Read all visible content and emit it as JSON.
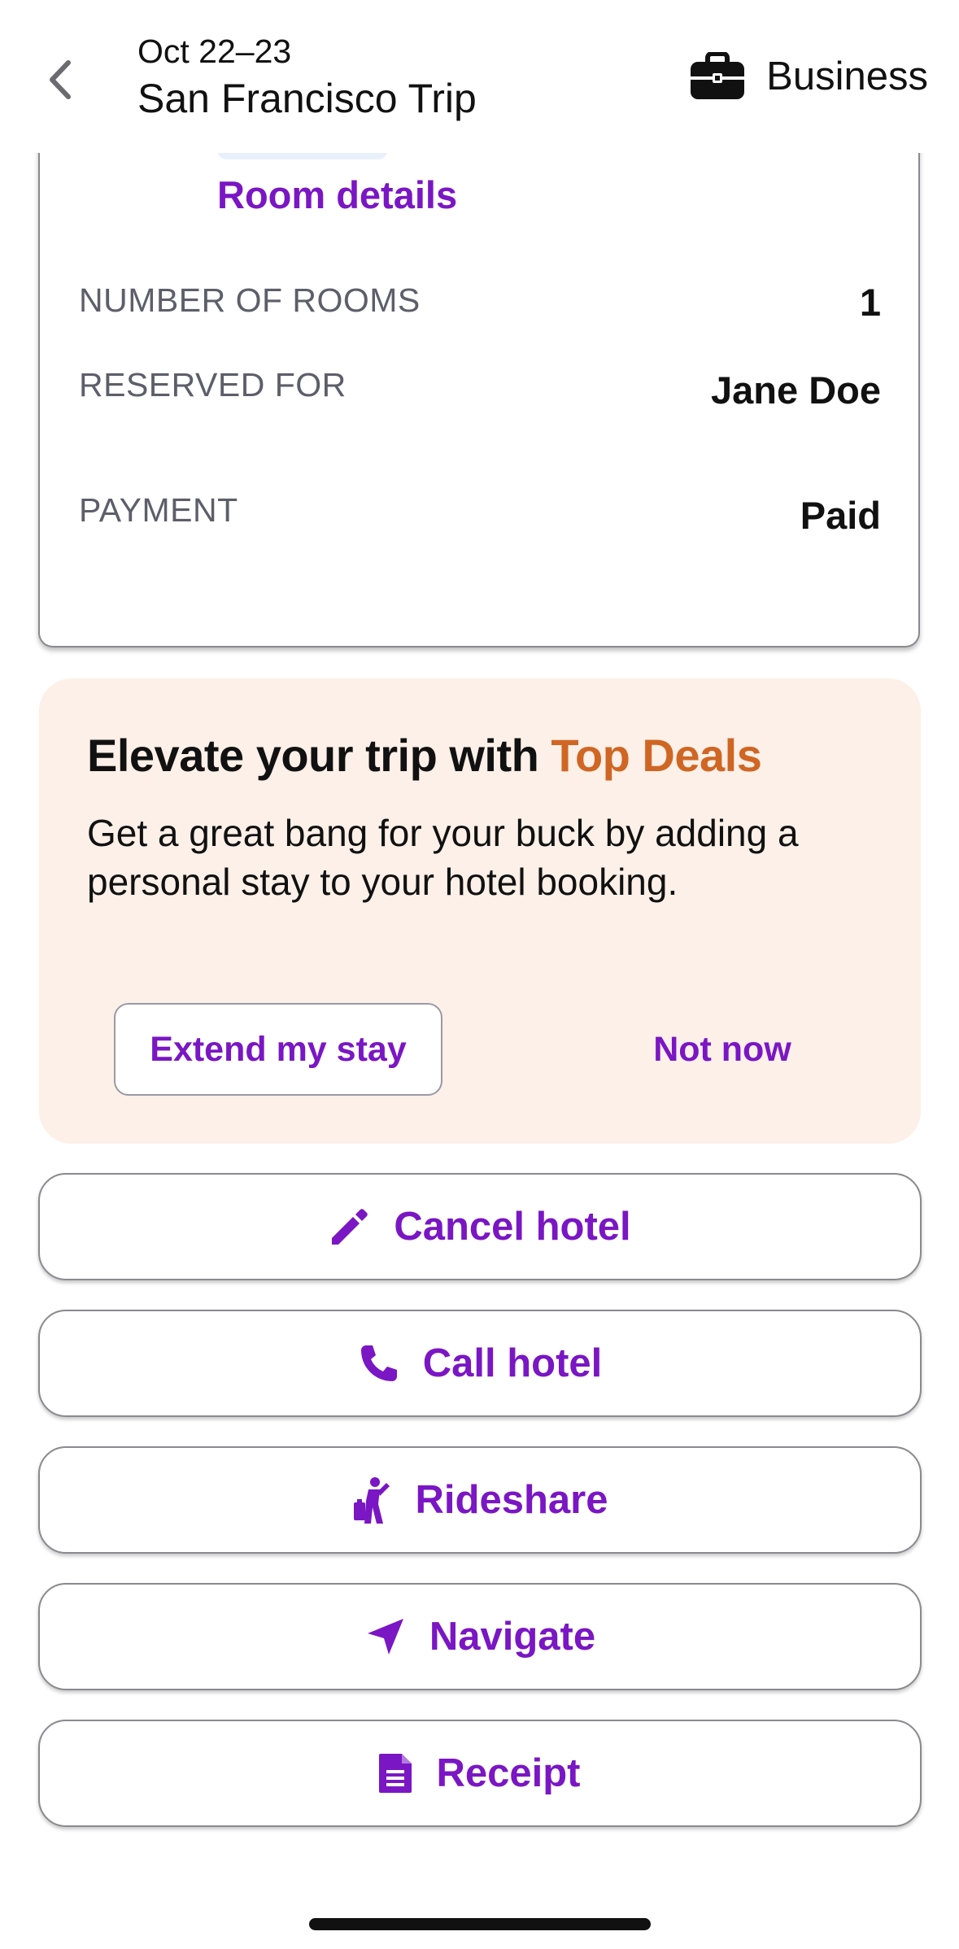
{
  "header": {
    "date": "Oct 22–23",
    "title": "San Francisco Trip",
    "trip_type": "Business",
    "back_icon": "chevron-left-icon",
    "trip_type_icon": "briefcase-icon"
  },
  "room_card": {
    "room_details_link": "Room details",
    "rows": [
      {
        "label": "NUMBER OF ROOMS",
        "value": "1"
      },
      {
        "label": "RESERVED FOR",
        "value": "Jane Doe"
      },
      {
        "label": "PAYMENT",
        "value": "Paid"
      }
    ]
  },
  "promo": {
    "title_prefix": "Elevate your trip with ",
    "title_accent": "Top Deals",
    "body": "Get a great bang for your buck by adding a personal stay to your hotel booking.",
    "primary_button": "Extend my stay",
    "secondary_button": "Not now"
  },
  "actions": [
    {
      "label": "Cancel hotel",
      "icon": "pencil-icon"
    },
    {
      "label": "Call hotel",
      "icon": "phone-icon"
    },
    {
      "label": "Rideshare",
      "icon": "rideshare-icon"
    },
    {
      "label": "Navigate",
      "icon": "navigate-arrow-icon"
    },
    {
      "label": "Receipt",
      "icon": "receipt-icon"
    }
  ],
  "colors": {
    "accent": "#7a16c4",
    "deal_accent": "#d06623",
    "promo_background": "#fdf0e8"
  }
}
